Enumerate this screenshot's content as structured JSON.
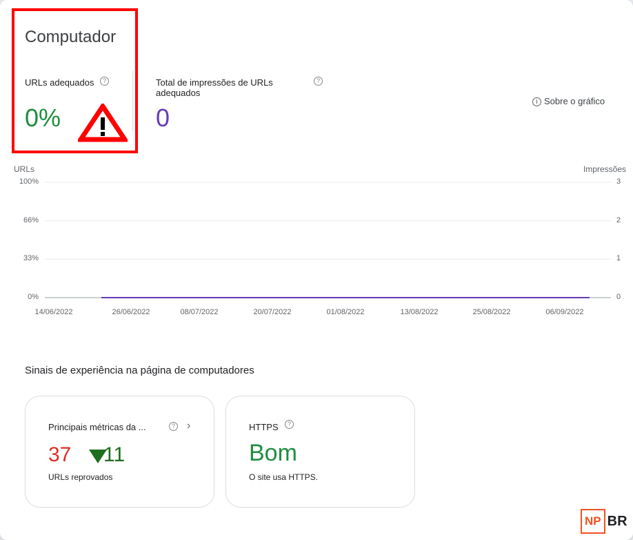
{
  "header": {
    "title": "Computador",
    "about_label": "Sobre o gráfico"
  },
  "metrics": [
    {
      "label": "URLs adequados",
      "value": "0%",
      "color": "#1e8e3e"
    },
    {
      "label": "Total de impressões de URLs adequados",
      "value": "0",
      "color": "#673ab7"
    }
  ],
  "icons": {
    "help": "?",
    "info": "i",
    "chevron": "›"
  },
  "chart_data": {
    "type": "line",
    "left_axis_title": "URLs",
    "right_axis_title": "Impressões",
    "y_left_ticks": [
      "100%",
      "66%",
      "33%",
      "0%"
    ],
    "y_right_ticks": [
      "3",
      "2",
      "1",
      "0"
    ],
    "x_ticks": [
      "14/06/2022",
      "26/06/2022",
      "08/07/2022",
      "20/07/2022",
      "01/08/2022",
      "13/08/2022",
      "25/08/2022",
      "06/09/2022"
    ],
    "ylim": [
      0,
      3
    ],
    "series": [
      {
        "values": [
          0,
          0,
          0,
          0,
          0,
          0,
          0,
          0
        ],
        "color": "#673ab7"
      }
    ],
    "grid": true
  },
  "signals": {
    "title": "Sinais de experiência na página de computadores",
    "cards": [
      {
        "label": "Principais métricas da ...",
        "value": "37",
        "delta": "11",
        "sub": "URLs reprovados"
      },
      {
        "label": "HTTPS",
        "value": "Bom",
        "sub": "O site usa HTTPS."
      }
    ]
  },
  "logo": {
    "np": "NP",
    "br": "BR"
  },
  "colors": {
    "accent_red": "#ff0000",
    "good": "#1e8e3e",
    "bad": "#d93025",
    "impressions": "#673ab7"
  }
}
